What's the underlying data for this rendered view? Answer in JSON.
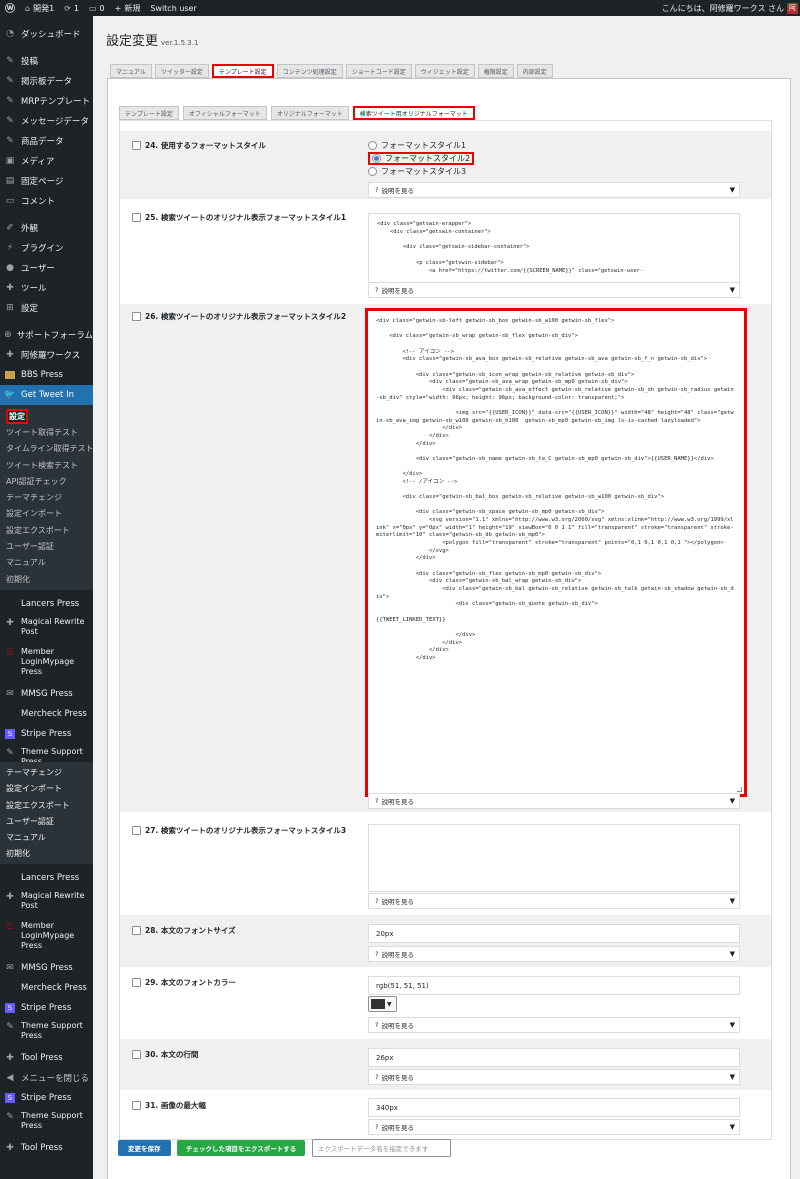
{
  "adminbar": {
    "site_name": "開発1",
    "updates_count": "1",
    "comments_count": "0",
    "new_label": "新規",
    "switch_user": "Switch user",
    "greeting": "こんにちは、阿修羅ワークス さん",
    "avatar_text": "阿"
  },
  "sidebar": {
    "items": [
      {
        "label": "ダッシュボード",
        "icon": "dashboard-icon"
      },
      {
        "label": "投稿",
        "icon": "pin-icon"
      },
      {
        "label": "掲示板データ",
        "icon": "pin-icon"
      },
      {
        "label": "MRPテンプレート",
        "icon": "pin-icon"
      },
      {
        "label": "メッセージデータ",
        "icon": "pin-icon"
      },
      {
        "label": "商品データ",
        "icon": "pin-icon"
      },
      {
        "label": "メディア",
        "icon": "media-icon"
      },
      {
        "label": "固定ページ",
        "icon": "page-icon"
      },
      {
        "label": "コメント",
        "icon": "comment-icon"
      },
      {
        "label": "外観",
        "icon": "brush-icon"
      },
      {
        "label": "プラグイン",
        "icon": "plugin-icon"
      },
      {
        "label": "ユーザー",
        "icon": "user-icon"
      },
      {
        "label": "ツール",
        "icon": "wrench-icon"
      },
      {
        "label": "設定",
        "icon": "settings-icon"
      },
      {
        "label": "サポートフォーラム",
        "icon": "support-icon"
      },
      {
        "label": "阿修羅ワークス",
        "icon": "wrench-icon"
      },
      {
        "label": "BBS Press",
        "icon": "bbs-icon"
      },
      {
        "label": "Get Tweet In",
        "icon": "twitter-icon"
      }
    ],
    "submenu": [
      "設定",
      "ツイート取得テスト",
      "タイムライン取得テスト",
      "ツイート検索テスト",
      "API認証チェック",
      "テーマチェンジ",
      "設定インポート",
      "設定エクスポート",
      "ユーザー認証",
      "マニュアル",
      "初期化"
    ],
    "plugins1": [
      "Lancers Press",
      "Magical Rewrite Post",
      "Member LoginMypage Press",
      "MMSG Press",
      "Mercheck Press",
      "Stripe Press",
      "Theme Support Press"
    ],
    "submenu2": [
      "テーマチェンジ",
      "設定インポート",
      "設定エクスポート",
      "ユーザー認証",
      "マニュアル",
      "初期化"
    ],
    "plugins2": [
      "Lancers Press",
      "Magical Rewrite Post",
      "Member LoginMypage Press",
      "MMSG Press",
      "Mercheck Press",
      "Stripe Press",
      "Theme Support Press",
      "Tool Press"
    ],
    "collapse_label": "メニューを閉じる",
    "plugins3": [
      "Stripe Press",
      "Theme Support Press",
      "Tool Press"
    ]
  },
  "page": {
    "title": "設定変更",
    "version": "ver.1.5.3.1"
  },
  "tabs_main": [
    "マニュアル",
    "ツイッター設定",
    "テンプレート設定",
    "コンテンツ処理設定",
    "ショートコード設定",
    "ウィジェット設定",
    "権限設定",
    "内部設定"
  ],
  "tabs_sub": [
    "テンプレート設定",
    "オフィシャルフォーマット",
    "オリジナルフォーマット",
    "検索ツイート用オリジナルフォーマット"
  ],
  "help_label": "説明を見る",
  "fields": {
    "f24": {
      "label": "24. 使用するフォーマットスタイル",
      "options": [
        "フォーマットスタイル1",
        "フォーマットスタイル2",
        "フォーマットスタイル3"
      ],
      "selected": 1
    },
    "f25": {
      "label": "25. 検索ツイートのオリジナル表示フォーマットスタイル1",
      "code": "<div class=\"getswin-wrapper\">\n    <div class=\"getswin-container\">\n\n        <div class=\"getswin-sidebar-container\">\n\n            <p class=\"getswin-sidebar\">\n                <a href=\"https://twitter.com/{{SCREEN_NAME}}\" class=\"getswin-user-"
    },
    "f26": {
      "label": "26. 検索ツイートのオリジナル表示フォーマットスタイル2",
      "code": "<div class=\"getwin-sb-left getwin-sb_box getwin-sb_w100 getwin-sb_flex\">\n\n    <div class=\"getwin-sb_wrap getwin-sb_flex getwin-sb_div\">\n\n        <!-- アイコン -->\n        <div class=\"getwin-sb_ava_box getwin-sb_relative getwin-sb_ava getwin-sb_f_n getwin-sb_div\">\n\n            <div class=\"getwin-sb_icon_wrap getwin-sb_relative getwin-sb_div\">\n                <div class=\"getwin-sb_ava_wrap getwin-sb_mp0 getwin-sb_div\">\n                    <div class=\"getwin-sb_ava_effect getwin-sb_relative getwin-sb_oh getwin-sb_radius getwin-sb_div\" style=\"width: 96px; height: 96px; background-color: transparent;\">\n\n                        <img src=\"{{USER_ICON}}\" data-src=\"{{USER_ICON}}\" width=\"48\" height=\"48\" class=\"getwin-sb_ava_img getwin-sb_w100 getwin-sb_h100  getwin-sb_mp0 getwin-sb_img ls-is-cached lazyloaded\">\n                    </div>\n                </div>\n            </div>\n\n            <div class=\"getwin-sb_name getwin-sb_ta_C getwin-sb_mp0 getwin-sb_div\">{{USER_NAME}}</div>\n\n        </div>\n        <!-- /アイコン -->\n\n        <div class=\"getwin-sb_bal_box getwin-sb_relative getwin-sb_w100 getwin-sb_div\">\n\n            <div class=\"getwin-sb_space getwin-sb_mp0 getwin-sb_div\">\n                <svg version=\"1.1\" xmlns=\"http://www.w3.org/2000/svg\" xmlns:xlink=\"http://www.w3.org/1999/xlink\" x=\"0px\" y=\"0px\" width=\"1\" height=\"19\" viewBox=\"0 0 1 1\" fill=\"transparent\" stroke=\"transparent\" stroke-miterlimit=\"10\" class=\"getwin-sb_db getwin-sb_mp0\">\n                    <polygon fill=\"transparent\" stroke=\"transparent\" points=\"0,1 0,1 0,1 0,1 \"></polygon>\n                </svg>\n            </div>\n\n            <div class=\"getwin-sb_flex getwin-sb_mp0 getwin-sb_div\">\n                <div class=\"getwin-sb_bal_wrap getwin-sb_div\">\n                    <div class=\"getwin-sb_bal getwin-sb_relative getwin-sb_talk getwin-sb_shadow getwin-sb_div\">\n                        <div class=\"getwin-sb_quote getwin-sb_div\">\n\n{{TWEET_LINKED_TEXT}}\n\n                        </div>\n                    </div>\n                </div>\n            </div>"
    },
    "f27": {
      "label": "27. 検索ツイートのオリジナル表示フォーマットスタイル3",
      "code": ""
    },
    "f28": {
      "label": "28. 本文のフォントサイズ",
      "value": "20px"
    },
    "f29": {
      "label": "29. 本文のフォントカラー",
      "value": "rgb(51, 51, 51)",
      "color": "#333333"
    },
    "f30": {
      "label": "30. 本文の行間",
      "value": "26px"
    },
    "f31": {
      "label": "31. 画像の最大幅",
      "value": "340px"
    }
  },
  "footer": {
    "save_label": "変更を保存",
    "export_label": "チェックした項目をエクスポートする",
    "export_placeholder": "エクスポートデータ名を指定できます"
  },
  "colors": {
    "accent": "#2271b1",
    "highlight": "#e00000",
    "export_button": "#28a745",
    "sidebar": "#1d2327"
  }
}
